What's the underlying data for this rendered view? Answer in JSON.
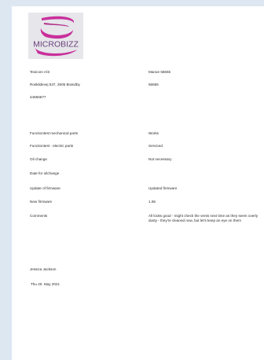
{
  "logo": {
    "text": "MICROBIZZ",
    "colors": {
      "swoosh": "#c9309a",
      "swoosh_dark": "#8e1f6c",
      "text": "#6b3f7a"
    }
  },
  "company": {
    "name": "Texicom A/S",
    "address": "Roskildevej 537, 2605 Brøndby",
    "phone": "44556677"
  },
  "machine": {
    "model": "Manoe 56655",
    "number": "56655"
  },
  "checks": [
    {
      "label": "Functiontest mechanical parts",
      "value": "Works"
    },
    {
      "label": "Functiontest - electric parts",
      "value": "Serviced"
    },
    {
      "label": "Oil change",
      "value": "Not necessary"
    },
    {
      "label": "Date for oilchange",
      "value": ""
    },
    {
      "label": "Update of firmware",
      "value": "Updated firmware"
    },
    {
      "label": "New firmware",
      "value": "1.65"
    },
    {
      "label": "Comments",
      "value": "All looks good - might check the vents next time as they seem overly dusty - they're cleaned now, but let's keep an eye on them"
    }
  ],
  "signature": {
    "name": "Jessica Jackson",
    "date": "Thu 20. May 2021"
  }
}
